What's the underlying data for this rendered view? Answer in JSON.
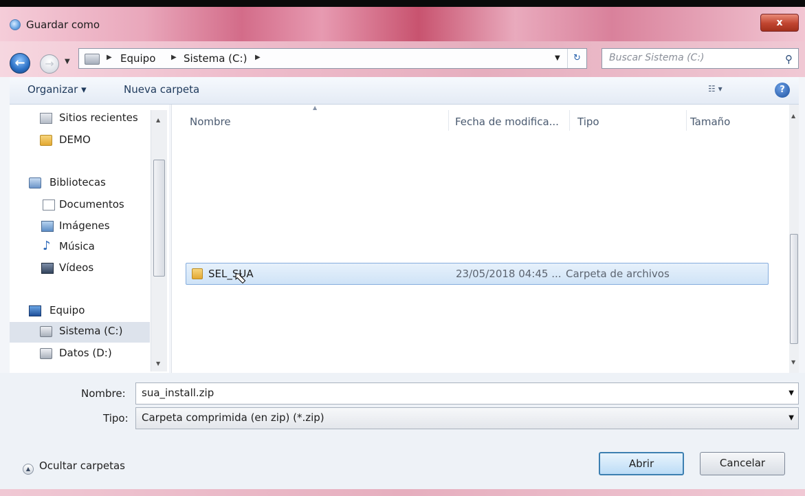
{
  "window": {
    "title": "Guardar como",
    "close_label": "x"
  },
  "address": {
    "crumbs": [
      "Equipo",
      "Sistema (C:)"
    ],
    "search_placeholder": "Buscar Sistema (C:)"
  },
  "toolbar": {
    "organize_label": "Organizar ▾",
    "new_folder_label": "Nueva carpeta",
    "view_label": "☷ ▾",
    "help_label": "?"
  },
  "nav": {
    "items": [
      {
        "label": "Sitios recientes",
        "icon": "recent-places-icon"
      },
      {
        "label": "DEMO",
        "icon": "folder-icon"
      },
      {
        "label": "Bibliotecas",
        "icon": "libraries-icon"
      },
      {
        "label": "Documentos",
        "icon": "documents-icon"
      },
      {
        "label": "Imágenes",
        "icon": "pictures-icon"
      },
      {
        "label": "Música",
        "icon": "music-icon"
      },
      {
        "label": "Vídeos",
        "icon": "videos-icon"
      },
      {
        "label": "Equipo",
        "icon": "computer-icon"
      },
      {
        "label": "Sistema (C:)",
        "icon": "drive-icon"
      },
      {
        "label": "Datos (D:)",
        "icon": "drive-icon"
      }
    ]
  },
  "columns": [
    "Nombre",
    "Fecha de modifica...",
    "Tipo",
    "Tamaño"
  ],
  "files": [
    {
      "name": "SEL_SUA",
      "date": "23/05/2018 04:45 ...",
      "type": "Carpeta de archivos",
      "size": ""
    }
  ],
  "form": {
    "name_label": "Nombre:",
    "name_value": "sua_install.zip",
    "type_label": "Tipo:",
    "type_value": "Carpeta comprimida (en zip) (*.zip)"
  },
  "footer": {
    "hide_folders_label": "Ocultar carpetas",
    "open_label": "Abrir",
    "cancel_label": "Cancelar"
  },
  "colors": {
    "title_bar": "#d36c89",
    "selection": "#cfe3f7",
    "accent": "#3c7fb1"
  }
}
